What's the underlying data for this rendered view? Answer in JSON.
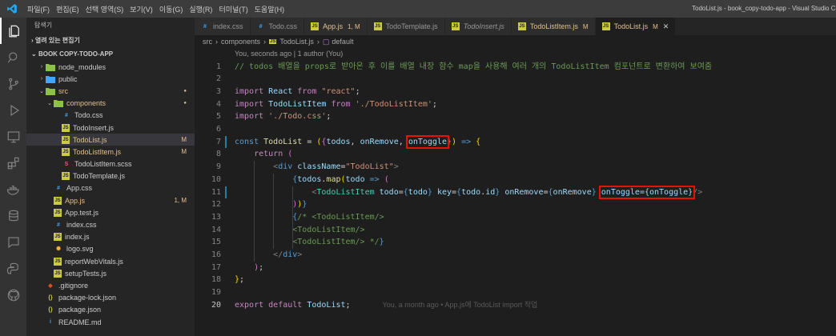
{
  "titlebar": {
    "menu": [
      "파일(F)",
      "편집(E)",
      "선택 영역(S)",
      "보기(V)",
      "이동(G)",
      "실행(R)",
      "터미널(T)",
      "도움말(H)"
    ],
    "window_title": "TodoList.js - book_copy-todo-app - Visual Studio Code"
  },
  "activity_icons": [
    "files-icon",
    "search-icon",
    "source-control-icon",
    "run-debug-icon",
    "remote-explorer-icon",
    "extensions-icon",
    "docker-icon",
    "database-icon",
    "live-share-icon",
    "python-icon",
    "github-icon"
  ],
  "sidebar": {
    "title": "탐색기",
    "open_editors": "열려 있는 편집기",
    "project": "BOOK COPY-TODO-APP",
    "items": [
      {
        "name": "node_modules",
        "type": "folder",
        "depth": 1,
        "chev": "›",
        "color": "#cccccc",
        "icon": "folder-icon"
      },
      {
        "name": "public",
        "type": "folder",
        "depth": 1,
        "chev": "›",
        "color": "#cccccc",
        "icon": "folder-icon"
      },
      {
        "name": "src",
        "type": "folder",
        "depth": 1,
        "chev": "⌄",
        "color": "#e2c08d",
        "icon": "folder-icon",
        "dot": true
      },
      {
        "name": "components",
        "type": "folder",
        "depth": 2,
        "chev": "⌄",
        "color": "#e2c08d",
        "icon": "folder-icon",
        "dot": true
      },
      {
        "name": "Todo.css",
        "type": "css",
        "depth": 3,
        "color": "#cccccc",
        "icon": "css-file-icon"
      },
      {
        "name": "TodoInsert.js",
        "type": "js",
        "depth": 3,
        "color": "#cccccc",
        "icon": "js-file-icon"
      },
      {
        "name": "TodoList.js",
        "type": "js",
        "depth": 3,
        "color": "#e2c08d",
        "icon": "js-file-icon",
        "badge": "M",
        "selected": true
      },
      {
        "name": "TodoListItem.js",
        "type": "js",
        "depth": 3,
        "color": "#e2c08d",
        "icon": "js-file-icon",
        "badge": "M"
      },
      {
        "name": "TodoListItem.scss",
        "type": "scss",
        "depth": 3,
        "color": "#cccccc",
        "icon": "scss-file-icon"
      },
      {
        "name": "TodoTemplate.js",
        "type": "js",
        "depth": 3,
        "color": "#cccccc",
        "icon": "js-file-icon"
      },
      {
        "name": "App.css",
        "type": "css",
        "depth": 2,
        "color": "#cccccc",
        "icon": "css-file-icon"
      },
      {
        "name": "App.js",
        "type": "js",
        "depth": 2,
        "color": "#e2c08d",
        "icon": "js-file-icon",
        "badge": "1, M"
      },
      {
        "name": "App.test.js",
        "type": "test",
        "depth": 2,
        "color": "#cccccc",
        "icon": "test-file-icon"
      },
      {
        "name": "index.css",
        "type": "css",
        "depth": 2,
        "color": "#cccccc",
        "icon": "css-file-icon"
      },
      {
        "name": "index.js",
        "type": "js",
        "depth": 2,
        "color": "#cccccc",
        "icon": "js-file-icon"
      },
      {
        "name": "logo.svg",
        "type": "svg",
        "depth": 2,
        "color": "#cccccc",
        "icon": "svg-file-icon"
      },
      {
        "name": "reportWebVitals.js",
        "type": "js",
        "depth": 2,
        "color": "#cccccc",
        "icon": "js-file-icon"
      },
      {
        "name": "setupTests.js",
        "type": "js",
        "depth": 2,
        "color": "#cccccc",
        "icon": "js-file-icon"
      },
      {
        "name": ".gitignore",
        "type": "git",
        "depth": 1,
        "color": "#cccccc",
        "icon": "git-file-icon"
      },
      {
        "name": "package-lock.json",
        "type": "json",
        "depth": 1,
        "color": "#cccccc",
        "icon": "json-file-icon"
      },
      {
        "name": "package.json",
        "type": "json",
        "depth": 1,
        "color": "#cccccc",
        "icon": "json-file-icon"
      },
      {
        "name": "README.md",
        "type": "md",
        "depth": 1,
        "color": "#cccccc",
        "icon": "info-file-icon"
      }
    ]
  },
  "tabs": [
    {
      "label": "index.css",
      "type": "css"
    },
    {
      "label": "Todo.css",
      "type": "css"
    },
    {
      "label": "App.js",
      "type": "js",
      "modified": "1, M",
      "color": "#e2c08d"
    },
    {
      "label": "TodoTemplate.js",
      "type": "js"
    },
    {
      "label": "TodoInsert.js",
      "type": "js",
      "italic": true
    },
    {
      "label": "TodoListItem.js",
      "type": "js",
      "modified": "M",
      "color": "#e2c08d"
    },
    {
      "label": "TodoList.js",
      "type": "js",
      "modified": "M",
      "color": "#e2c08d",
      "active": true
    }
  ],
  "breadcrumb": {
    "parts": [
      "src",
      "components",
      "TodoList.js",
      "default"
    ],
    "sep": "›"
  },
  "codelens": "You, seconds ago | 1 author (You)",
  "blame": "You, a month ago • App.js에 TodoList import 작업",
  "current_line": 20,
  "code": [
    [
      [
        "c",
        "// todos 배열을 props로 받아온 후 이를 배열 내장 함수 map을 사용해 여러 개의 TodoListItem 컴포넌트로 변환하여 보여줌"
      ]
    ],
    [],
    [
      [
        "kc",
        "import"
      ],
      [
        "d",
        " "
      ],
      [
        "v",
        "React"
      ],
      [
        "d",
        " "
      ],
      [
        "kc",
        "from"
      ],
      [
        "d",
        " "
      ],
      [
        "s",
        "\"react\""
      ],
      [
        "d",
        ";"
      ]
    ],
    [
      [
        "kc",
        "import"
      ],
      [
        "d",
        " "
      ],
      [
        "v",
        "TodoListItem"
      ],
      [
        "d",
        " "
      ],
      [
        "kc",
        "from"
      ],
      [
        "d",
        " "
      ],
      [
        "s",
        "'./TodoListItem'"
      ],
      [
        "d",
        ";"
      ]
    ],
    [
      [
        "kc",
        "import"
      ],
      [
        "d",
        " "
      ],
      [
        "s",
        "'./Todo.css'"
      ],
      [
        "d",
        ";"
      ]
    ],
    [],
    [
      [
        "k",
        "const"
      ],
      [
        "d",
        " "
      ],
      [
        "f",
        "TodoList"
      ],
      [
        "d",
        " = "
      ],
      [
        "p",
        "("
      ],
      [
        "p2",
        "{"
      ],
      [
        "v",
        "todos"
      ],
      [
        "d",
        ", "
      ],
      [
        "v",
        "onRemove"
      ],
      [
        "d",
        ", "
      ],
      [
        "v",
        "onToggle",
        "hl"
      ],
      [
        "p2",
        "}"
      ],
      [
        "p",
        ")"
      ],
      [
        "d",
        " "
      ],
      [
        "k",
        "=>"
      ],
      [
        "d",
        " "
      ],
      [
        "p",
        "{"
      ]
    ],
    [
      [
        "d",
        "    "
      ],
      [
        "kc",
        "return"
      ],
      [
        "d",
        " "
      ],
      [
        "p2",
        "("
      ]
    ],
    [
      [
        "d",
        "        "
      ],
      [
        "g",
        "<"
      ],
      [
        "k",
        "div"
      ],
      [
        "d",
        " "
      ],
      [
        "v",
        "className"
      ],
      [
        "d",
        "="
      ],
      [
        "s",
        "\"TodoList\""
      ],
      [
        "g",
        ">"
      ]
    ],
    [
      [
        "d",
        "            "
      ],
      [
        "k",
        "{"
      ],
      [
        "v",
        "todos"
      ],
      [
        "d",
        "."
      ],
      [
        "f",
        "map"
      ],
      [
        "p",
        "("
      ],
      [
        "v",
        "todo"
      ],
      [
        "d",
        " "
      ],
      [
        "k",
        "=>"
      ],
      [
        "d",
        " "
      ],
      [
        "p2",
        "("
      ]
    ],
    [
      [
        "d",
        "                "
      ],
      [
        "g",
        "<"
      ],
      [
        "t",
        "TodoListItem"
      ],
      [
        "d",
        " "
      ],
      [
        "v",
        "todo"
      ],
      [
        "d",
        "="
      ],
      [
        "k",
        "{"
      ],
      [
        "v",
        "todo"
      ],
      [
        "k",
        "}"
      ],
      [
        "d",
        " "
      ],
      [
        "v",
        "key"
      ],
      [
        "d",
        "="
      ],
      [
        "k",
        "{"
      ],
      [
        "v",
        "todo"
      ],
      [
        "d",
        "."
      ],
      [
        "v",
        "id"
      ],
      [
        "k",
        "}"
      ],
      [
        "d",
        " "
      ],
      [
        "v",
        "onRemove"
      ],
      [
        "d",
        "="
      ],
      [
        "k",
        "{"
      ],
      [
        "v",
        "onRemove"
      ],
      [
        "k",
        "}"
      ],
      [
        "d",
        " "
      ],
      [
        "v",
        "onToggle={onToggle}",
        "hl"
      ],
      [
        "g",
        "/>"
      ]
    ],
    [
      [
        "d",
        "            "
      ],
      [
        "p2",
        ")"
      ],
      [
        "p",
        ")"
      ],
      [
        "k",
        "}"
      ]
    ],
    [
      [
        "d",
        "            "
      ],
      [
        "k",
        "{"
      ],
      [
        "c",
        "/* <TodoListItem/>"
      ]
    ],
    [
      [
        "d",
        "            "
      ],
      [
        "c",
        "<TodoListItem/>"
      ]
    ],
    [
      [
        "d",
        "            "
      ],
      [
        "c",
        "<TodoListItem/> */"
      ],
      [
        "k",
        "}"
      ]
    ],
    [
      [
        "d",
        "        "
      ],
      [
        "g",
        "</"
      ],
      [
        "k",
        "div"
      ],
      [
        "g",
        ">"
      ]
    ],
    [
      [
        "d",
        "    "
      ],
      [
        "p2",
        ")"
      ],
      [
        "d",
        ";"
      ]
    ],
    [
      [
        "p",
        "}"
      ],
      [
        "d",
        ";"
      ]
    ],
    [],
    [
      [
        "kc",
        "export"
      ],
      [
        "d",
        " "
      ],
      [
        "kc",
        "default"
      ],
      [
        "d",
        " "
      ],
      [
        "v",
        "TodoList"
      ],
      [
        "d",
        ";"
      ]
    ]
  ]
}
